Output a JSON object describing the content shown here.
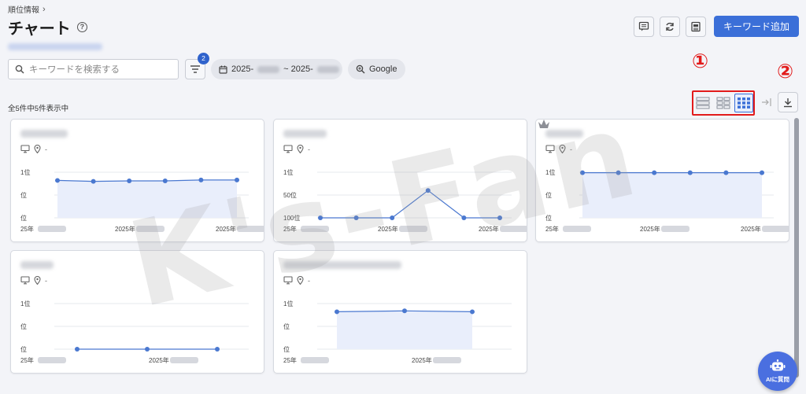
{
  "breadcrumb": {
    "label": "順位情報",
    "chevron": "›"
  },
  "page": {
    "title": "チャート",
    "help": "?"
  },
  "actions": {
    "add_keyword": "キーワード追加"
  },
  "search": {
    "placeholder": "キーワードを検索する"
  },
  "filter": {
    "badge": "2"
  },
  "date_range": {
    "start_prefix": "2025-",
    "separator": "~ 2025-"
  },
  "engine": {
    "label": "Google"
  },
  "count_text": "全5件中5件表示中",
  "markers": {
    "one": "①",
    "two": "②"
  },
  "watermark": "K's-Fan",
  "ai_button": {
    "label": "AIに質問"
  },
  "colors": {
    "accent": "#3b6fd8",
    "highlight": "#e21b1b",
    "line": "#4a78d0",
    "fill": "#e9eefb"
  },
  "cards": [
    {
      "y_labels": [
        "1位",
        "位",
        "位"
      ],
      "x_labels": [
        "25年",
        "2025年",
        "2025年"
      ],
      "values": [
        0.82,
        0.8,
        0.81,
        0.81,
        0.83,
        0.83
      ]
    },
    {
      "y_labels": [
        "1位",
        "50位",
        "100位"
      ],
      "x_labels": [
        "25年",
        "2025年",
        "2025年"
      ],
      "values": [
        0.0,
        0.0,
        0.0,
        0.6,
        0.0,
        0.0
      ]
    },
    {
      "y_labels": [
        "1位",
        "位",
        "位"
      ],
      "x_labels": [
        "25年",
        "2025年",
        "2025年"
      ],
      "values": [
        0.99,
        0.99,
        0.99,
        0.99,
        0.99,
        0.99
      ]
    },
    {
      "y_labels": [
        "1位",
        "位",
        "位"
      ],
      "x_labels": [
        "25年",
        "2025年"
      ],
      "values": [
        0.0,
        0.0,
        0.0
      ]
    },
    {
      "y_labels": [
        "1位",
        "位",
        "位"
      ],
      "x_labels": [
        "25年",
        "2025年"
      ],
      "values": [
        0.82,
        0.84,
        0.82
      ]
    }
  ]
}
